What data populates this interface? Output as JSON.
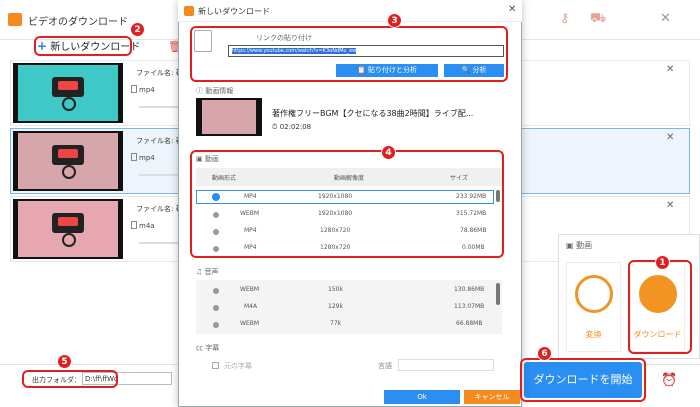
{
  "window": {
    "title": "ビデオのダウンロード",
    "new_download": "新しいダウンロード"
  },
  "rows": [
    {
      "fname": "ファイル名: 著",
      "format": "mp4",
      "selected": false
    },
    {
      "fname": "ファイル名: 著",
      "format": "mp4",
      "selected": true
    },
    {
      "fname": "ファイル名: 著",
      "format": "m4a",
      "selected": false
    }
  ],
  "bottom": {
    "output_label": "出力フォルダ：",
    "output_value": "D:\\ff\\ffWq",
    "start_button": "ダウンロードを開始"
  },
  "side_panel": {
    "title": "動画",
    "convert_label": "変換",
    "download_label": "ダウンロード"
  },
  "dialog": {
    "title": "新しいダウンロード",
    "paste_section": "リンクの貼り付け",
    "url": "https://www.youtube.com/watch?v=K3oNdMu_ew",
    "paste_analyze": "貼り付けと分析",
    "analyze": "分析",
    "info_section": "動画情報",
    "video_title": "著作権フリーBGM【クセになる38曲2時間】ライブ配...",
    "duration": "02:02:08",
    "video_section": "動画",
    "headers": {
      "format": "動画形式",
      "resolution": "動画解像度",
      "size": "サイズ"
    },
    "video_rows": [
      {
        "format": "MP4",
        "resolution": "1920x1080",
        "size": "233.92MB",
        "selected": true
      },
      {
        "format": "WEBM",
        "resolution": "1920x1080",
        "size": "315.72MB",
        "selected": false
      },
      {
        "format": "MP4",
        "resolution": "1280x720",
        "size": "78.86MB",
        "selected": false
      },
      {
        "format": "MP4",
        "resolution": "1280x720",
        "size": "0.00MB",
        "selected": false
      }
    ],
    "audio_section": "音声",
    "audio_rows": [
      {
        "format": "WEBM",
        "bitrate": "150k",
        "size": "130.86MB"
      },
      {
        "format": "M4A",
        "bitrate": "129k",
        "size": "113.07MB"
      },
      {
        "format": "WEBM",
        "bitrate": "77k",
        "size": "66.88MB"
      }
    ],
    "subtitle_section": "字幕",
    "original_subtitle": "元の字幕",
    "language_label": "言語",
    "ok": "Ok",
    "cancel": "キャンセル"
  },
  "badges": {
    "b1": "1",
    "b2": "2",
    "b3": "3",
    "b4": "4",
    "b5": "5",
    "b6": "6"
  },
  "colors": {
    "accent_blue": "#2a8ff0",
    "accent_orange": "#f28a1e",
    "highlight_red": "#e02020"
  }
}
